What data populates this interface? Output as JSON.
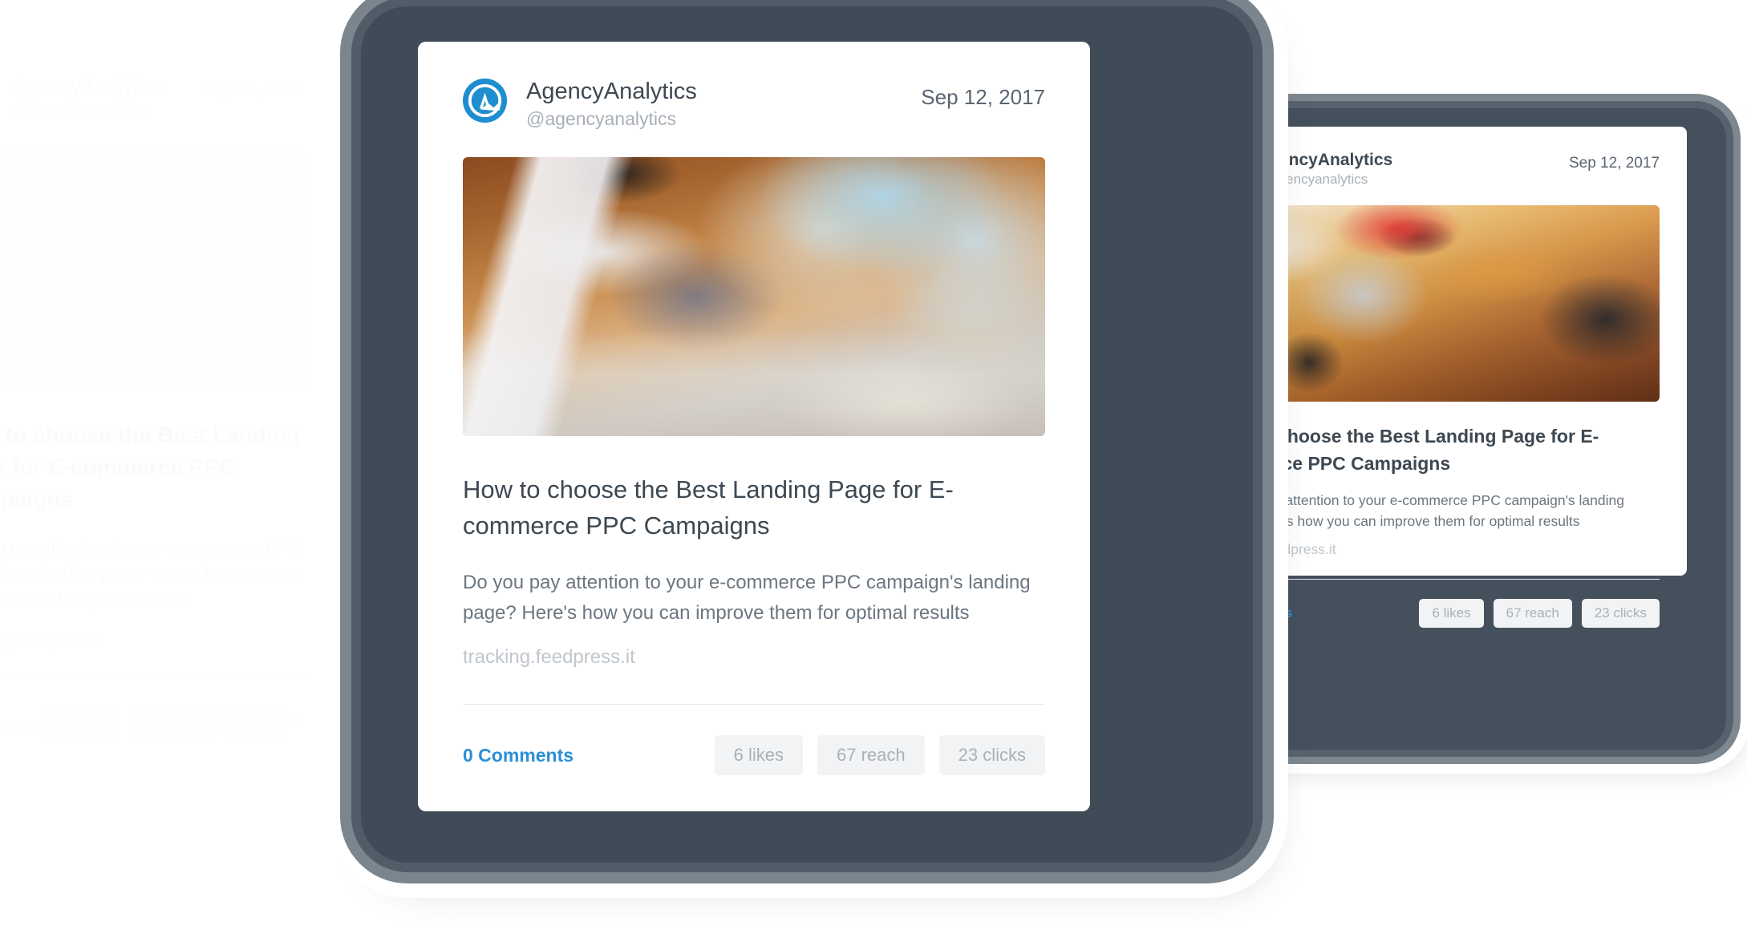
{
  "brand": {
    "accent_blue": "#2b8fd6",
    "avatar_blue": "#1d8ed0",
    "text_dark": "#3d4852",
    "text_muted": "#6b7680",
    "text_faint": "#a9b0b7",
    "pill_bg": "#f2f3f5",
    "bezel_dark": "#3f4b56",
    "bezel_mid": "#505c67",
    "bezel_light": "#7b858d"
  },
  "post": {
    "account_name": "AgencyAnalytics",
    "account_handle": "@agencyanalytics",
    "date": "Sep 12, 2017",
    "title": "How to choose the Best Landing Page for E-commerce PPC Campaigns",
    "description": "Do you pay attention to your e-commerce PPC campaign's landing page? Here's how you can improve them for optimal results",
    "url": "tracking.feedpress.it",
    "comments_label": "0 Comments",
    "stats": [
      {
        "label": "6 likes",
        "name": "likes"
      },
      {
        "label": "67 reach",
        "name": "reach"
      },
      {
        "label": "23 clicks",
        "name": "clicks"
      }
    ],
    "avatar_icon": "agencyanalytics-logo-icon",
    "photo_center": "person-typing-on-laptop-at-desk-photo",
    "photo_right": "person-with-laptop-and-coffee-mug-photo",
    "photo_left": "pens-and-notebook-on-desk-photo"
  }
}
